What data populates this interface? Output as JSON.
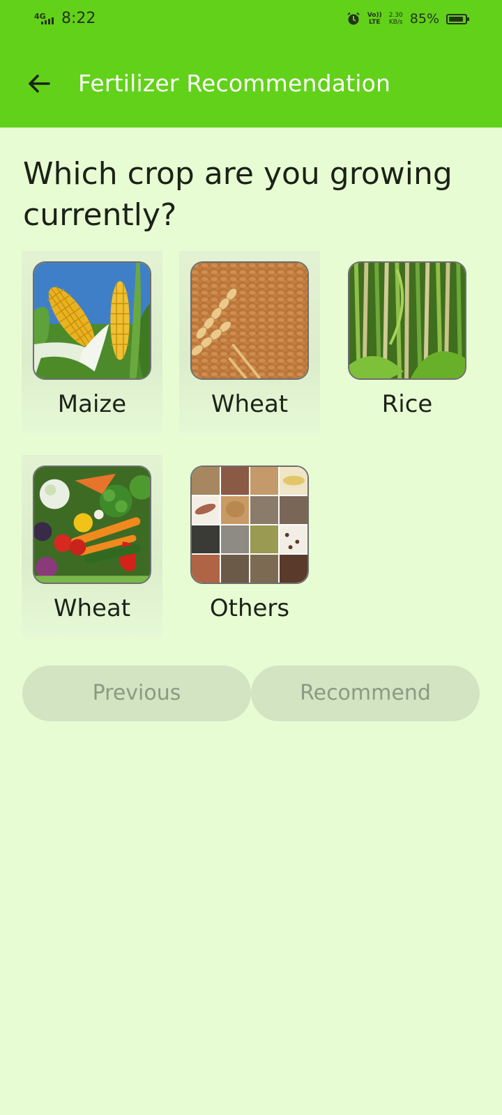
{
  "status_bar": {
    "network": "4G",
    "time": "8:22",
    "volte_top": "Vo))",
    "volte_bottom": "LTE",
    "speed_value": "2.30",
    "speed_unit": "KB/s",
    "battery": "85%"
  },
  "app_bar": {
    "title": "Fertilizer Recommendation",
    "back_icon": "arrow-left-icon"
  },
  "question": "Which crop are you growing currently?",
  "crops": [
    {
      "label": "Maize"
    },
    {
      "label": "Wheat"
    },
    {
      "label": "Rice"
    },
    {
      "label": "Wheat"
    },
    {
      "label": "Others"
    }
  ],
  "buttons": {
    "previous": "Previous",
    "recommend": "Recommend"
  },
  "colors": {
    "app_bar": "#62d11a",
    "background": "#e8fcd4",
    "button_bg": "#d2e4c2",
    "button_text": "#8b9a83"
  }
}
